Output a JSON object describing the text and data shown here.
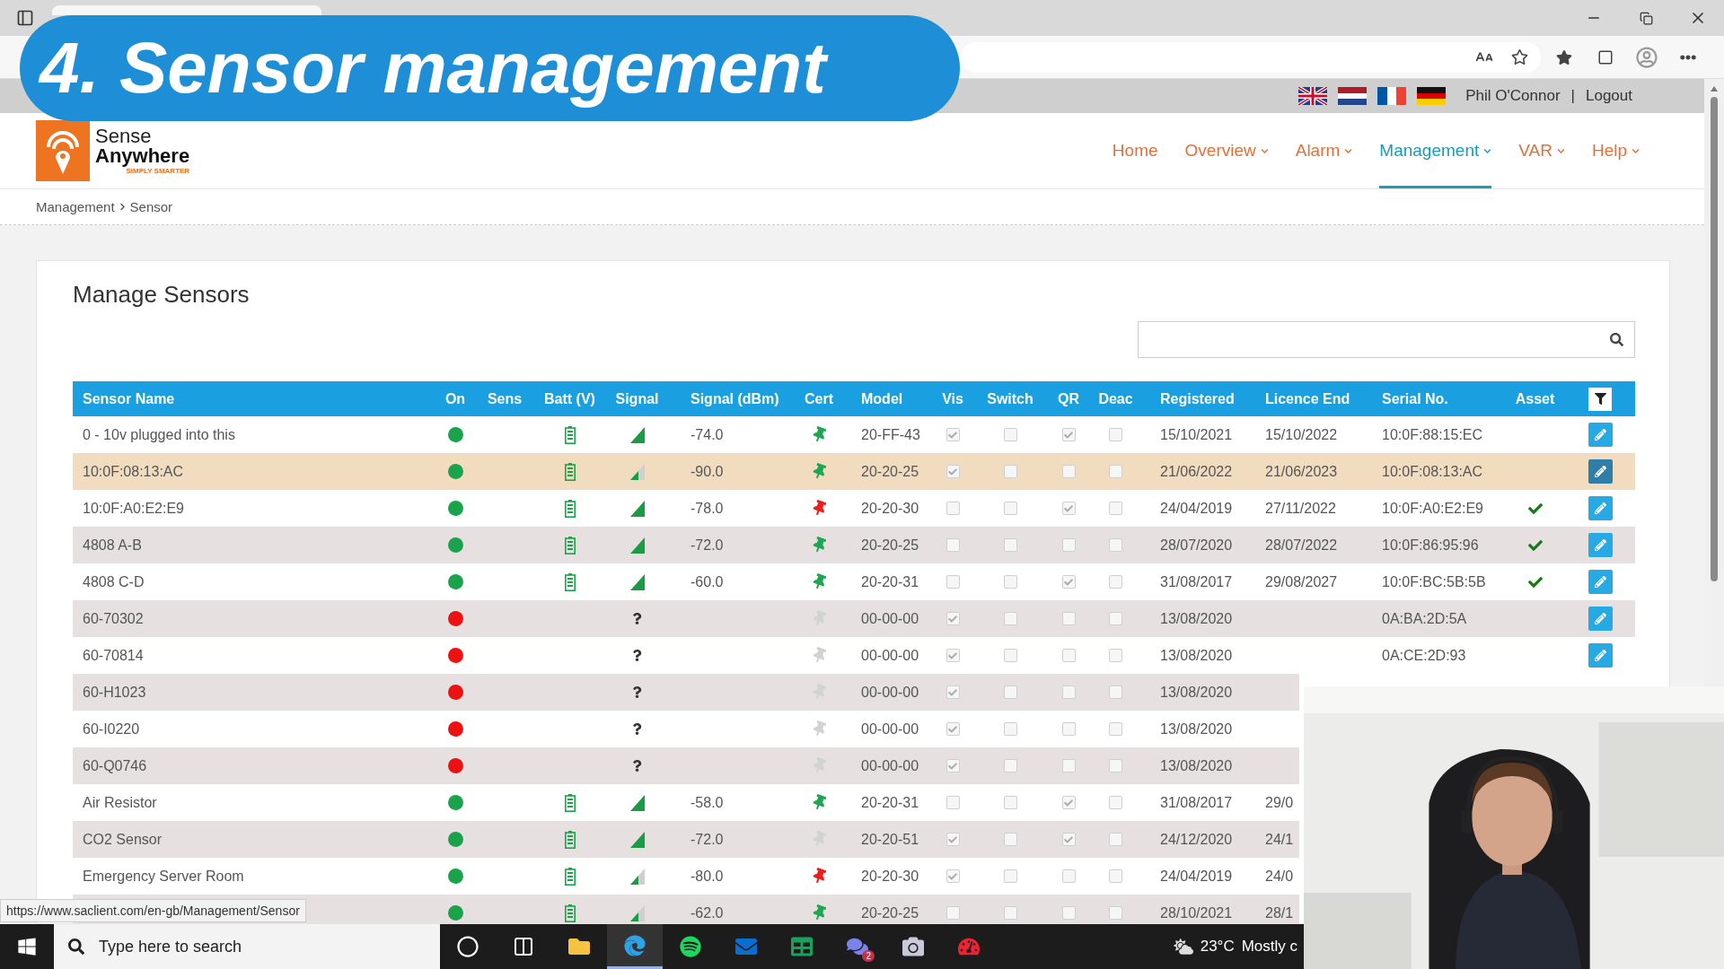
{
  "banner": {
    "title": "4. Sensor management"
  },
  "header": {
    "flags": [
      {
        "kind": "uk"
      },
      {
        "kind": "nl"
      },
      {
        "kind": "fr"
      },
      {
        "kind": "de"
      }
    ],
    "user": "Phil O'Connor",
    "separator": "|",
    "logout": "Logout"
  },
  "logo": {
    "line1": "Sense",
    "line2": "Anywhere",
    "tagline": "SIMPLY SMARTER"
  },
  "nav": [
    {
      "label": "Home",
      "dropdown": false,
      "selected": false
    },
    {
      "label": "Overview",
      "dropdown": true,
      "selected": false
    },
    {
      "label": "Alarm",
      "dropdown": true,
      "selected": false
    },
    {
      "label": "Management",
      "dropdown": true,
      "selected": true
    },
    {
      "label": "VAR",
      "dropdown": true,
      "selected": false
    },
    {
      "label": "Help",
      "dropdown": true,
      "selected": false
    }
  ],
  "breadcrumb": [
    "Management",
    "Sensor"
  ],
  "page_title": "Manage Sensors",
  "table": {
    "columns": [
      "Sensor Name",
      "On",
      "Sens",
      "Batt (V)",
      "Signal",
      "Signal (dBm)",
      "Cert",
      "Model",
      "Vis",
      "Switch",
      "QR",
      "Deac",
      "Registered",
      "Licence End",
      "Serial No.",
      "Asset"
    ],
    "rows": [
      {
        "name": "0 - 10v plugged into this",
        "on": true,
        "battery": true,
        "signal": {
          "kind": "bars"
        },
        "dbm": "-74.0",
        "cert": {
          "kind": "valid"
        },
        "model": "20-FF-43",
        "visible": true,
        "switch": false,
        "qr": true,
        "deactivated": false,
        "registered": "15/10/2021",
        "licence_end": "15/10/2022",
        "serial": "10:0F:88:15:EC",
        "asset": false,
        "edit": true,
        "selected": false
      },
      {
        "name": "10:0F:08:13:AC",
        "on": true,
        "battery": true,
        "signal": {
          "kind": "weak"
        },
        "dbm": "-90.0",
        "cert": {
          "kind": "valid"
        },
        "model": "20-20-25",
        "visible": true,
        "switch": false,
        "qr": false,
        "deactivated": false,
        "registered": "21/06/2022",
        "licence_end": "21/06/2023",
        "serial": "10:0F:08:13:AC",
        "asset": false,
        "edit": true,
        "selected": true
      },
      {
        "name": "10:0F:A0:E2:E9",
        "on": true,
        "battery": true,
        "signal": {
          "kind": "bars"
        },
        "dbm": "-78.0",
        "cert": {
          "kind": "expired"
        },
        "model": "20-20-30",
        "visible": false,
        "switch": false,
        "qr": true,
        "deactivated": false,
        "registered": "24/04/2019",
        "licence_end": "27/11/2022",
        "serial": "10:0F:A0:E2:E9",
        "asset": true,
        "edit": true,
        "selected": false
      },
      {
        "name": "4808 A-B",
        "on": true,
        "battery": true,
        "signal": {
          "kind": "bars"
        },
        "dbm": "-72.0",
        "cert": {
          "kind": "valid"
        },
        "model": "20-20-25",
        "visible": false,
        "switch": false,
        "qr": false,
        "deactivated": false,
        "registered": "28/07/2020",
        "licence_end": "28/07/2022",
        "serial": "10:0F:86:95:96",
        "asset": true,
        "edit": true,
        "selected": false
      },
      {
        "name": "4808 C-D",
        "on": true,
        "battery": true,
        "signal": {
          "kind": "bars"
        },
        "dbm": "-60.0",
        "cert": {
          "kind": "valid"
        },
        "model": "20-20-31",
        "visible": false,
        "switch": false,
        "qr": true,
        "deactivated": false,
        "registered": "31/08/2017",
        "licence_end": "29/08/2027",
        "serial": "10:0F:BC:5B:5B",
        "asset": true,
        "edit": true,
        "selected": false
      },
      {
        "name": "60-70302",
        "on": false,
        "battery": false,
        "signal": {
          "kind": "unknown"
        },
        "cert": {
          "kind": "none"
        },
        "model": "00-00-00",
        "visible": true,
        "switch": false,
        "qr": false,
        "deactivated": false,
        "registered": "13/08/2020",
        "serial": "0A:BA:2D:5A",
        "asset": false,
        "edit": true,
        "selected": false
      },
      {
        "name": "60-70814",
        "on": false,
        "battery": false,
        "signal": {
          "kind": "unknown"
        },
        "cert": {
          "kind": "none"
        },
        "model": "00-00-00",
        "visible": true,
        "switch": false,
        "qr": false,
        "deactivated": false,
        "registered": "13/08/2020",
        "serial": "0A:CE:2D:93",
        "asset": false,
        "edit": true,
        "selected": false
      },
      {
        "name": "60-H1023",
        "on": false,
        "battery": false,
        "signal": {
          "kind": "unknown"
        },
        "cert": {
          "kind": "none"
        },
        "model": "00-00-00",
        "visible": true,
        "switch": false,
        "qr": false,
        "deactivated": false,
        "registered": "13/08/2020",
        "asset": false,
        "edit": false,
        "selected": false
      },
      {
        "name": "60-I0220",
        "on": false,
        "battery": false,
        "signal": {
          "kind": "unknown"
        },
        "cert": {
          "kind": "none"
        },
        "model": "00-00-00",
        "visible": true,
        "switch": false,
        "qr": false,
        "deactivated": false,
        "registered": "13/08/2020",
        "asset": false,
        "edit": false,
        "selected": false
      },
      {
        "name": "60-Q0746",
        "on": false,
        "battery": false,
        "signal": {
          "kind": "unknown"
        },
        "cert": {
          "kind": "none"
        },
        "model": "00-00-00",
        "visible": true,
        "switch": false,
        "qr": false,
        "deactivated": false,
        "registered": "13/08/2020",
        "asset": false,
        "edit": false,
        "selected": false
      },
      {
        "name": "Air Resistor",
        "on": true,
        "battery": true,
        "signal": {
          "kind": "bars"
        },
        "dbm": "-58.0",
        "cert": {
          "kind": "valid"
        },
        "model": "20-20-31",
        "visible": false,
        "switch": false,
        "qr": true,
        "deactivated": false,
        "registered": "31/08/2017",
        "licence_end": "29/0",
        "asset": false,
        "edit": false,
        "selected": false
      },
      {
        "name": "CO2 Sensor",
        "on": true,
        "battery": true,
        "signal": {
          "kind": "bars"
        },
        "dbm": "-72.0",
        "cert": {
          "kind": "none"
        },
        "model": "20-20-51",
        "visible": true,
        "switch": false,
        "qr": true,
        "deactivated": false,
        "registered": "24/12/2020",
        "licence_end": "24/1",
        "asset": false,
        "edit": false,
        "selected": false
      },
      {
        "name": "Emergency Server Room",
        "on": true,
        "battery": true,
        "signal": {
          "kind": "weak"
        },
        "dbm": "-80.0",
        "cert": {
          "kind": "expired"
        },
        "model": "20-20-30",
        "visible": true,
        "switch": false,
        "qr": false,
        "deactivated": false,
        "registered": "24/04/2019",
        "licence_end": "24/0",
        "asset": false,
        "edit": false,
        "selected": false
      },
      {
        "on": true,
        "battery": true,
        "signal": {
          "kind": "weak"
        },
        "dbm": "-62.0",
        "cert": {
          "kind": "valid"
        },
        "model": "20-20-25",
        "visible": false,
        "switch": false,
        "qr": false,
        "deactivated": false,
        "registered": "28/10/2021",
        "licence_end": "28/1",
        "asset": false,
        "edit": false,
        "selected": false
      }
    ]
  },
  "status_url": "https://www.saclient.com/en-gb/Management/Sensor",
  "taskbar": {
    "search_placeholder": "Type here to search",
    "apps": [
      {
        "kind": "cortana",
        "selected": false
      },
      {
        "kind": "taskview",
        "selected": false
      },
      {
        "kind": "folder",
        "selected": false
      },
      {
        "kind": "browser",
        "selected": true
      },
      {
        "kind": "music",
        "selected": false
      },
      {
        "kind": "mail",
        "selected": false
      },
      {
        "kind": "sheet",
        "selected": false
      },
      {
        "kind": "chat",
        "selected": false,
        "badge": "2"
      },
      {
        "kind": "camera",
        "selected": false
      },
      {
        "kind": "gauge",
        "selected": false
      }
    ],
    "temperature": "23°C",
    "weather": "Mostly c"
  }
}
